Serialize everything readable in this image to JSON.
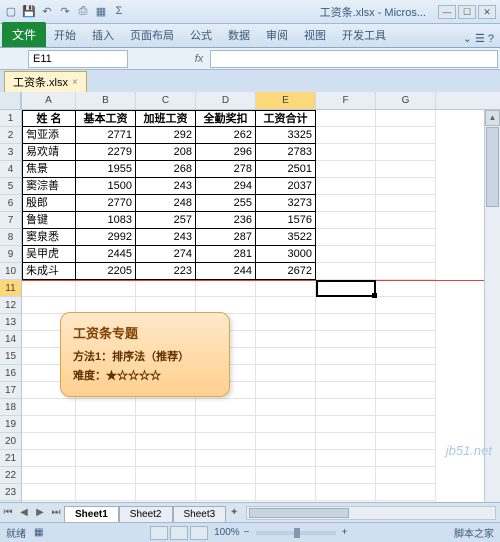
{
  "title": "工资条.xlsx - Micros...",
  "ribbon": {
    "file": "文件",
    "tabs": [
      "开始",
      "插入",
      "页面布局",
      "公式",
      "数据",
      "审阅",
      "视图",
      "开发工具"
    ]
  },
  "namebox": "E11",
  "wbtab": "工资条.xlsx",
  "colhdrs": [
    "A",
    "B",
    "C",
    "D",
    "E",
    "F",
    "G"
  ],
  "rowCount": 23,
  "headers": [
    "姓 名",
    "基本工资",
    "加班工资",
    "全勤奖扣",
    "工资合计"
  ],
  "rows": [
    [
      "訇亚添",
      "2771",
      "292",
      "262",
      "3325"
    ],
    [
      "易欢靖",
      "2279",
      "208",
      "296",
      "2783"
    ],
    [
      "焦景",
      "1955",
      "268",
      "278",
      "2501"
    ],
    [
      "窦淙善",
      "1500",
      "243",
      "294",
      "2037"
    ],
    [
      "殷郎",
      "2770",
      "248",
      "255",
      "3273"
    ],
    [
      "鲁键",
      "1083",
      "257",
      "236",
      "1576"
    ],
    [
      "窦泉悉",
      "2992",
      "243",
      "287",
      "3522"
    ],
    [
      "吴甲虎",
      "2445",
      "274",
      "281",
      "3000"
    ],
    [
      "朱成斗",
      "2205",
      "223",
      "244",
      "2672"
    ]
  ],
  "callout": {
    "title": "工资条专题",
    "line1": "方法1：排序法（推荐）",
    "line2": "难度：★☆☆☆☆"
  },
  "watermark": "jb51.net",
  "sheets": [
    "Sheet1",
    "Sheet2",
    "Sheet3"
  ],
  "status": {
    "ready": "就绪",
    "mode": "",
    "zoom": "100%",
    "zin": "+",
    "zout": "−",
    "footer": "脚本之家"
  },
  "activeCell": "E11",
  "chart_data": {
    "type": "table",
    "title": "工资条",
    "columns": [
      "姓 名",
      "基本工资",
      "加班工资",
      "全勤奖扣",
      "工资合计"
    ],
    "data": [
      {
        "姓 名": "訇亚添",
        "基本工资": 2771,
        "加班工资": 292,
        "全勤奖扣": 262,
        "工资合计": 3325
      },
      {
        "姓 名": "易欢靖",
        "基本工资": 2279,
        "加班工资": 208,
        "全勤奖扣": 296,
        "工资合计": 2783
      },
      {
        "姓 名": "焦景",
        "基本工资": 1955,
        "加班工资": 268,
        "全勤奖扣": 278,
        "工资合计": 2501
      },
      {
        "姓 名": "窦淙善",
        "基本工资": 1500,
        "加班工资": 243,
        "全勤奖扣": 294,
        "工资合计": 2037
      },
      {
        "姓 名": "殷郎",
        "基本工资": 2770,
        "加班工资": 248,
        "全勤奖扣": 255,
        "工资合计": 3273
      },
      {
        "姓 名": "鲁键",
        "基本工资": 1083,
        "加班工资": 257,
        "全勤奖扣": 236,
        "工资合计": 1576
      },
      {
        "姓 名": "窦泉悉",
        "基本工资": 2992,
        "加班工资": 243,
        "全勤奖扣": 287,
        "工资合计": 3522
      },
      {
        "姓 名": "吴甲虎",
        "基本工资": 2445,
        "加班工资": 274,
        "全勤奖扣": 281,
        "工资合计": 3000
      },
      {
        "姓 名": "朱成斗",
        "基本工资": 2205,
        "加班工资": 223,
        "全勤奖扣": 244,
        "工资合计": 2672
      }
    ]
  }
}
